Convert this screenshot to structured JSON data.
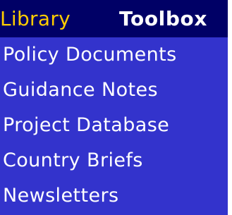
{
  "tabs": {
    "library": "Library",
    "toolbox": "Toolbox"
  },
  "menu": {
    "items": [
      {
        "label": "Policy Documents"
      },
      {
        "label": "Guidance Notes"
      },
      {
        "label": "Project Database"
      },
      {
        "label": "Country Briefs"
      },
      {
        "label": "Newsletters"
      }
    ]
  },
  "colors": {
    "header_background": "#000066",
    "panel_background": "#3333cc",
    "active_tab": "#ffcc00",
    "text": "#ffffff"
  }
}
